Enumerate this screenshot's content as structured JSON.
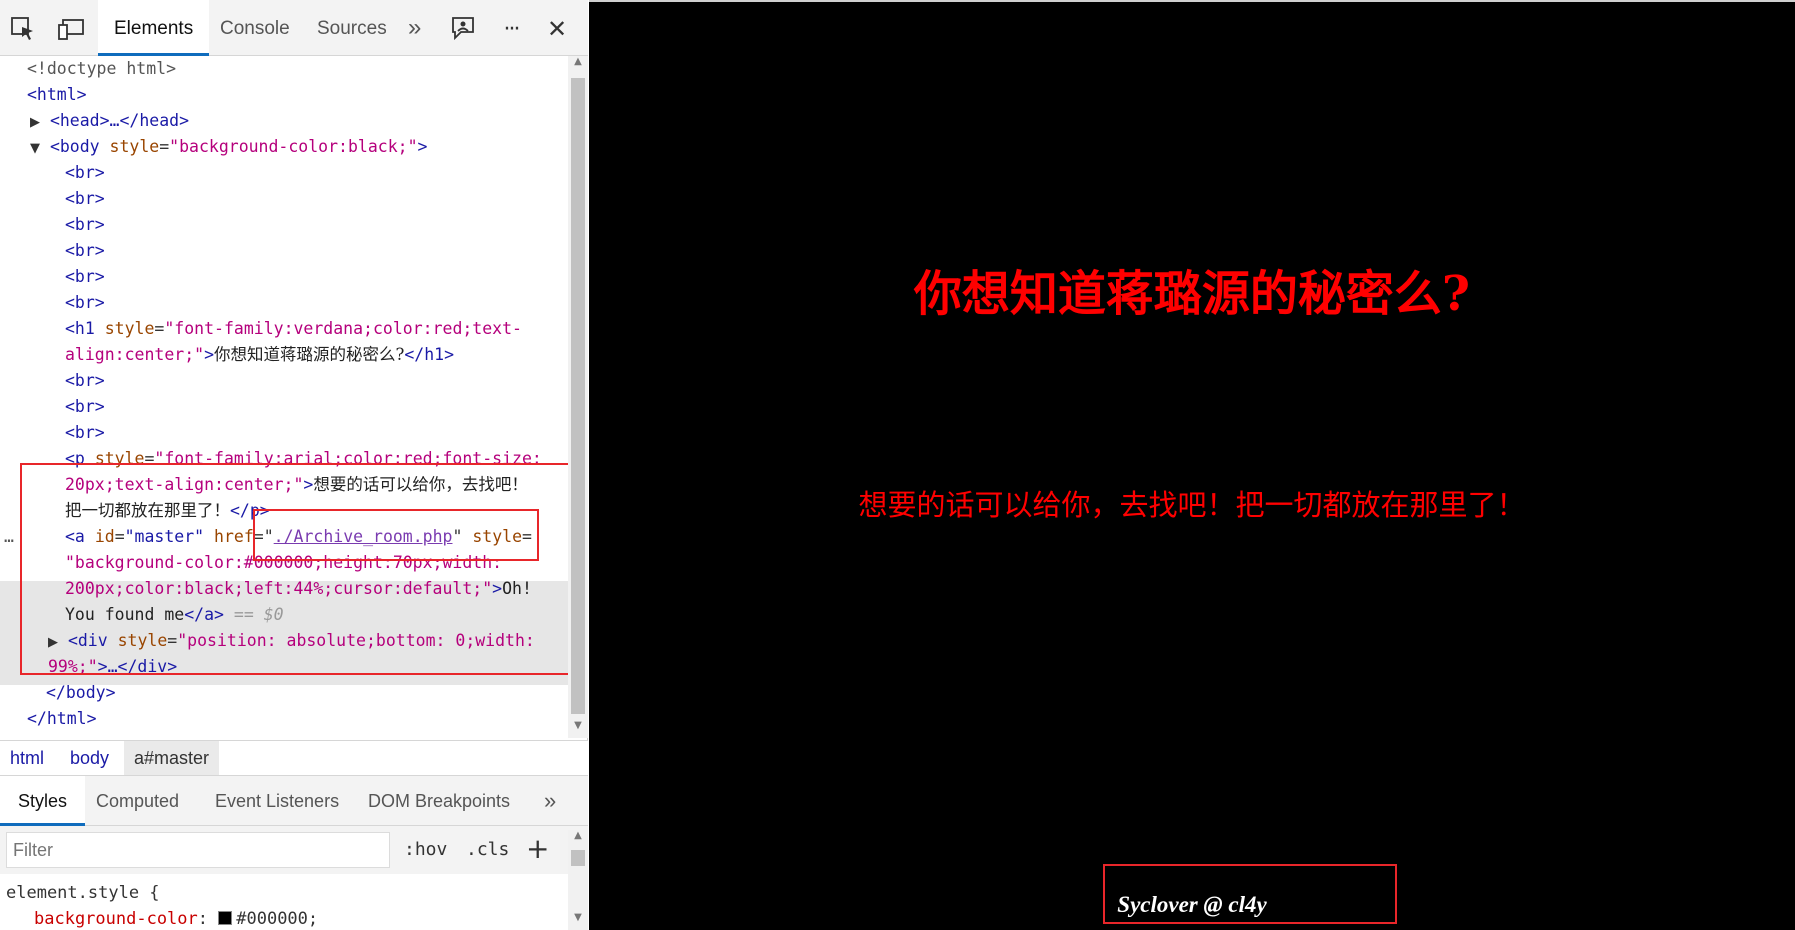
{
  "toolbar": {
    "tabs": {
      "elements": "Elements",
      "console": "Console",
      "sources": "Sources"
    },
    "more_tabs": "»",
    "more_menu": "···",
    "close": "✕"
  },
  "dom": {
    "doctype": "<!doctype html>",
    "html_open": "<html>",
    "head_collapsed": "<head>…</head>",
    "body_open_tag": "<body",
    "body_attr_name": "style",
    "body_attr_value": "\"background-color:black;\"",
    "br": "<br>",
    "h1_open": "<h1",
    "h1_attr_name": "style",
    "h1_attr_value_1": "\"font-family:verdana;color:red;text-",
    "h1_attr_value_2": "align:center;\"",
    "h1_text": "你想知道蒋璐源的秘密么?",
    "h1_close": "</h1>",
    "p_open": "<p",
    "p_attr_name": "style",
    "p_attr_value_1": "\"font-family:arial;color:red;font-size:",
    "p_attr_value_2": "20px;text-align:center;\"",
    "p_text_1": "想要的话可以给你，去找吧！",
    "p_text_2": "把一切都放在那里了！",
    "p_close": "</p>",
    "a_open": "<a",
    "a_id_name": "id",
    "a_id_value": "\"master\"",
    "a_href_name": "href",
    "a_href_value": "./Archive_room.php",
    "a_style_name": "style",
    "a_style_value_1": "\"background-color:#000000;height:70px;width:",
    "a_style_value_2": "200px;color:black;left:44%;cursor:default;\"",
    "a_text_1": "Oh!",
    "a_text_2": "You found me",
    "a_close": "</a>",
    "a_eq": "== $0",
    "div_open": "<div",
    "div_attr_name": "style",
    "div_attr_value_1": "\"position: absolute;bottom: 0;width:",
    "div_attr_value_2": "99%;\"",
    "div_collapsed": "…</div>",
    "body_close": "</body>",
    "html_close": "</html>"
  },
  "breadcrumbs": [
    "html",
    "body",
    "a#master"
  ],
  "styles_tabs": [
    "Styles",
    "Computed",
    "Event Listeners",
    "DOM Breakpoints"
  ],
  "filter": {
    "placeholder": "Filter",
    "hov": ":hov",
    "cls": ".cls",
    "add": "+"
  },
  "styles": {
    "selector": "element.style {",
    "prop": "background-color",
    "value": "#000000;"
  },
  "page": {
    "h1": "你想知道蒋璐源的秘密么?",
    "p": "想要的话可以给你，去找吧！把一切都放在那里了！",
    "credit": "Syclover @ cl4y"
  },
  "colors": {
    "page_text": "#ff0000",
    "highlight_box": "#e8262a",
    "accent": "#0f6cbd"
  }
}
